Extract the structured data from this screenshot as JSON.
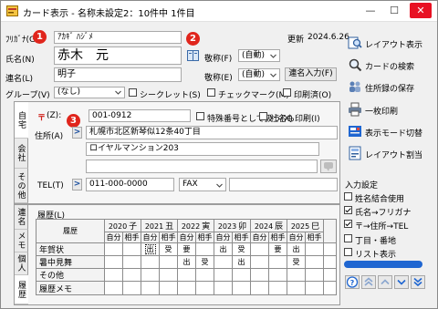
{
  "window": {
    "title": "カード表示 - 名称未設定2：10件中 1件目",
    "controls": {
      "minimize": "—",
      "maximize": "☐",
      "close": "✕"
    }
  },
  "markers": {
    "m1": "1",
    "m2": "2",
    "m3": "3"
  },
  "card": {
    "furigana": {
      "label": "ﾌﾘｶﾞﾅ(G)",
      "value": "ｱｶｷﾞ ﾊｼﾞﾒ"
    },
    "updated": {
      "label": "更新",
      "date": "2024.6.26"
    },
    "name": {
      "label": "氏名(N)",
      "value": "赤木　元",
      "honorific_label": "敬称(F)",
      "honorific_value": "(自動)"
    },
    "joint": {
      "label": "連名(L)",
      "value": "明子",
      "honorific_label": "敬称(E)",
      "honorific_value": "(自動)",
      "input_button": "連名入力(F)"
    },
    "group": {
      "label": "グループ(V)",
      "value": "(なし)"
    },
    "flags": [
      {
        "label": "シークレット(S)",
        "checked": false
      },
      {
        "label": "チェックマーク(M)",
        "checked": false
      },
      {
        "label": "印刷済(O)",
        "checked": false
      }
    ]
  },
  "address_tabs": [
    {
      "label": "自宅",
      "selected": true
    },
    {
      "label": "会社",
      "selected": false
    },
    {
      "label": "その他",
      "selected": false
    }
  ],
  "address": {
    "zip_mark": "〒",
    "zip_label": "(Z):",
    "zip_value": "001-0912",
    "options": [
      {
        "label": "特殊番号として扱う(X)",
        "checked": false
      },
      {
        "label": "社名も印刷(I)",
        "checked": false
      }
    ],
    "address_label": "住所(A)",
    "expand": ">",
    "line1": "札幌市北区新琴似12条40丁目",
    "line2": "ロイヤルマンション203",
    "line3": "",
    "tel_label": "TEL(T)",
    "tel_value": "011-000-0000",
    "phone_type": "FAX",
    "phone_value": ""
  },
  "lower_tabs": [
    {
      "label": "連名",
      "selected": false
    },
    {
      "label": "メモ",
      "selected": false
    },
    {
      "label": "個人",
      "selected": false
    },
    {
      "label": "履歴",
      "selected": true
    }
  ],
  "history": {
    "label": "履歴(L)",
    "corner": "履歴",
    "years": [
      {
        "year": "2020",
        "eto": "子"
      },
      {
        "year": "2021",
        "eto": "丑"
      },
      {
        "year": "2022",
        "eto": "寅"
      },
      {
        "year": "2023",
        "eto": "卯"
      },
      {
        "year": "2024",
        "eto": "辰"
      },
      {
        "year": "2025",
        "eto": "巳"
      }
    ],
    "sub": [
      "自分",
      "相手"
    ],
    "rows": [
      {
        "label": "年賀状",
        "cells": [
          "",
          "",
          "出",
          "受",
          "要",
          "",
          "出",
          "受",
          "",
          "要",
          "出",
          ""
        ]
      },
      {
        "label": "暑中見舞",
        "cells": [
          "",
          "",
          "",
          "",
          "出",
          "受",
          "",
          "出",
          "",
          "",
          "受",
          ""
        ]
      },
      {
        "label": "その他",
        "cells": [
          "",
          "",
          "",
          "",
          "",
          "",
          "",
          "",
          "",
          "",
          "",
          ""
        ]
      },
      {
        "label": "履歴メモ",
        "cells": [
          "",
          "",
          "",
          "",
          "",
          "",
          "",
          "",
          "",
          "",
          "",
          ""
        ]
      }
    ]
  },
  "sidebar": {
    "buttons": [
      {
        "label": "レイアウト表示",
        "icon": "layout-view-icon"
      },
      {
        "label": "カードの検索",
        "icon": "card-search-icon"
      },
      {
        "label": "住所録の保存",
        "icon": "address-book-save-icon"
      },
      {
        "label": "一枚印刷",
        "icon": "printer-icon"
      },
      {
        "label": "表示モード切替",
        "icon": "display-mode-icon"
      },
      {
        "label": "レイアウト割当",
        "icon": "layout-assign-icon"
      }
    ],
    "input_settings_label": "入力設定",
    "settings": [
      {
        "label": "姓名結合使用",
        "checked": false
      },
      {
        "label": "氏名→フリガナ",
        "checked": true
      },
      {
        "label": "〒→住所→TEL",
        "checked": true
      },
      {
        "label": "丁目・番地",
        "checked": false
      },
      {
        "label": "リスト表示",
        "checked": false
      }
    ],
    "nav": {
      "help": "?"
    }
  },
  "colors": {
    "marker": "#e0251c",
    "accent_blue": "#1f66d1",
    "zip_mark": "#d0201a"
  }
}
